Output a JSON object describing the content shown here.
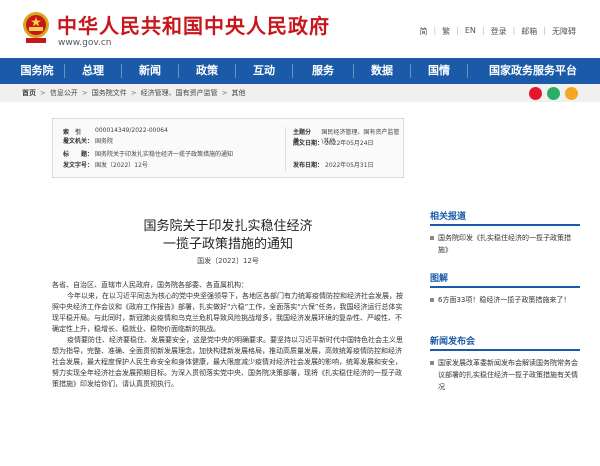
{
  "header": {
    "title": "中华人民共和国中央人民政府",
    "url": "www.gov.cn",
    "lang_links": [
      "简",
      "繁",
      "EN",
      "登录",
      "邮箱",
      "无障碍"
    ]
  },
  "nav": {
    "items": [
      "国务院",
      "总理",
      "新闻",
      "政策",
      "互动",
      "服务",
      "数据",
      "国情",
      "国家政务服务平台"
    ]
  },
  "breadcrumb": {
    "items": [
      "首页",
      "信息公开",
      "国务院文件",
      "经济管理、国有资产监管",
      "其他"
    ],
    "separator": ">",
    "share_icons": [
      "weibo-icon",
      "wechat-icon",
      "qzone-icon"
    ]
  },
  "meta": {
    "index_label": "索　引　号：",
    "index_value": "000014349/2022-00064",
    "subject_label": "主题分类：",
    "subject_value": "国民经济管理、国有资产监管\\其他",
    "issuer_label": "发文机关：",
    "issuer_value": "国务院",
    "date_written_label": "成文日期：",
    "date_written_value": "2022年05月24日",
    "title_label": "标　　题：",
    "title_value": "国务院关于印发扎实稳住经济一揽子政策措施的通知",
    "docno_label": "发文字号：",
    "docno_value": "国发〔2022〕12号",
    "pubdate_label": "发布日期：",
    "pubdate_value": "2022年05月31日"
  },
  "document": {
    "title_line1": "国务院关于印发扎实稳住经济",
    "title_line2": "一揽子政策措施的通知",
    "doc_number": "国发〔2022〕12号",
    "salutation": "各省、自治区、直辖市人民政府，国务院各部委、各直属机构：",
    "para1": "今年以来，在以习近平同志为核心的党中央坚强领导下，各地区各部门有力统筹疫情防控和经济社会发展，按照中央经济工作会议和《政府工作报告》部署，扎实做好“六稳”工作，全面落实“六保”任务，我国经济运行总体实现平稳开局。与此同时，新冠肺炎疫情和乌克兰危机导致风险挑战增多，我国经济发展环境的复杂性、严峻性、不确定性上升，稳增长、稳就业、稳物价面临新的挑战。",
    "para2": "疫情要防住、经济要稳住、发展要安全，这是党中央的明确要求。要坚持以习近平新时代中国特色社会主义思想为指导，完整、准确、全面贯彻新发展理念，加快构建新发展格局，推动高质量发展，高效统筹疫情防控和经济社会发展，最大程度保护人民生命安全和身体健康，最大限度减少疫情对经济社会发展的影响，统筹发展和安全，努力实现全年经济社会发展预期目标。为深入贯彻落实党中央、国务院决策部署，现将《扎实稳住经济的一揽子政策措施》印发给你们，请认真贯彻执行。"
  },
  "sidebar": {
    "related": {
      "heading": "相关报道",
      "items": [
        "国务院印发《扎实稳住经济的一揽子政策措施》"
      ]
    },
    "graphic": {
      "heading": "图解",
      "items": [
        "6方面33项！稳经济一揽子政策措施来了！"
      ]
    },
    "press": {
      "heading": "新闻发布会",
      "items": [
        "国家发展改革委新闻发布会解读国务院常务会议部署的扎实稳住经济一揽子政策措施有关情况"
      ]
    }
  },
  "colors": {
    "brand_red": "#c8161d",
    "nav_blue": "#1a5aa8"
  }
}
